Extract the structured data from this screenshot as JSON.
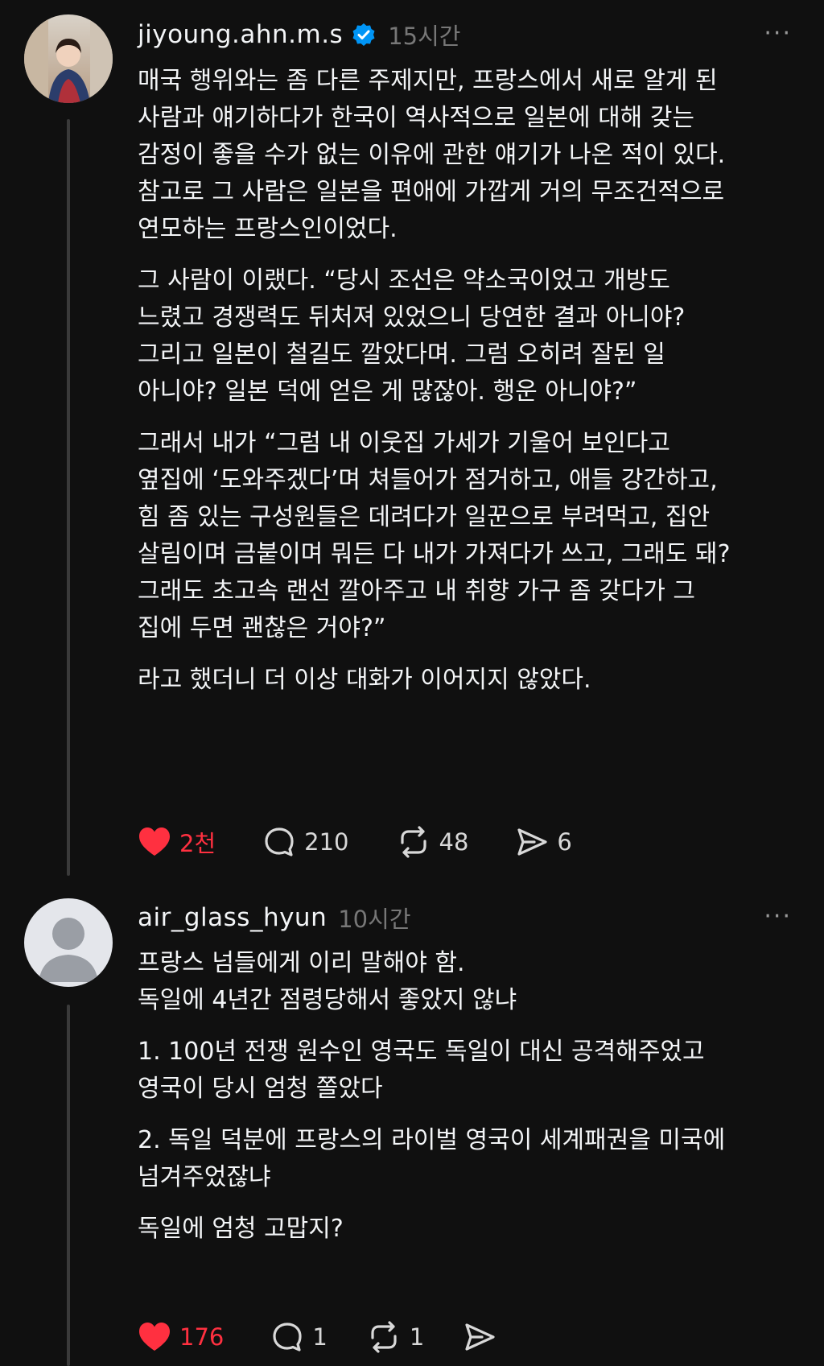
{
  "posts": [
    {
      "username": "jiyoung.ahn.m.s",
      "time": "15시간",
      "more": "···",
      "paragraphs": [
        "매국 행위와는 좀 다른 주제지만, 프랑스에서 새로 알게 된\n사람과 얘기하다가 한국이 역사적으로 일본에 대해 갖는\n감정이 좋을 수가 없는 이유에 관한 얘기가 나온 적이 있다.\n참고로 그 사람은 일본을 편애에 가깝게 거의 무조건적으로\n연모하는 프랑스인이었다.",
        "그 사람이 이랬다. “당시 조선은 약소국이었고 개방도\n느렸고 경쟁력도 뒤처져 있었으니 당연한 결과 아니야?\n그리고 일본이 철길도 깔았다며. 그럼 오히려 잘된 일\n아니야? 일본 덕에 얻은 게 많잖아. 행운 아니야?”",
        "그래서 내가 “그럼 내 이웃집 가세가 기울어 보인다고\n옆집에 ‘도와주겠다’며 쳐들어가 점거하고, 애들 강간하고,\n힘 좀 있는 구성원들은 데려다가 일꾼으로 부려먹고, 집안\n살림이며 금붙이며 뭐든 다 내가 가져다가 쓰고, 그래도 돼?\n그래도 초고속 랜선 깔아주고 내 취향 가구 좀 갖다가 그\n집에 두면 괜찮은 거야?”",
        "라고 했더니 더 이상 대화가 이어지지 않았다."
      ],
      "likes": "2천",
      "comments": "210",
      "reposts": "48",
      "shares": "6"
    },
    {
      "username": "air_glass_hyun",
      "time": "10시간",
      "more": "···",
      "paragraphs": [
        "프랑스 넘들에게 이리 말해야 함.\n독일에 4년간 점령당해서 좋았지 않냐",
        "1. 100년 전쟁 원수인 영국도 독일이 대신 공격해주었고\n영국이 당시 엄청 쫄았다",
        "2. 독일 덕분에 프랑스의 라이벌 영국이 세계패권을 미국에\n넘겨주었잖냐",
        "독일에 엄청 고맙지?"
      ],
      "likes": "176",
      "comments": "1",
      "reposts": "1",
      "shares": ""
    }
  ],
  "colors": {
    "background": "#101010",
    "liked": "#ff3040",
    "verified": "#0095f6",
    "muted": "#777777"
  }
}
